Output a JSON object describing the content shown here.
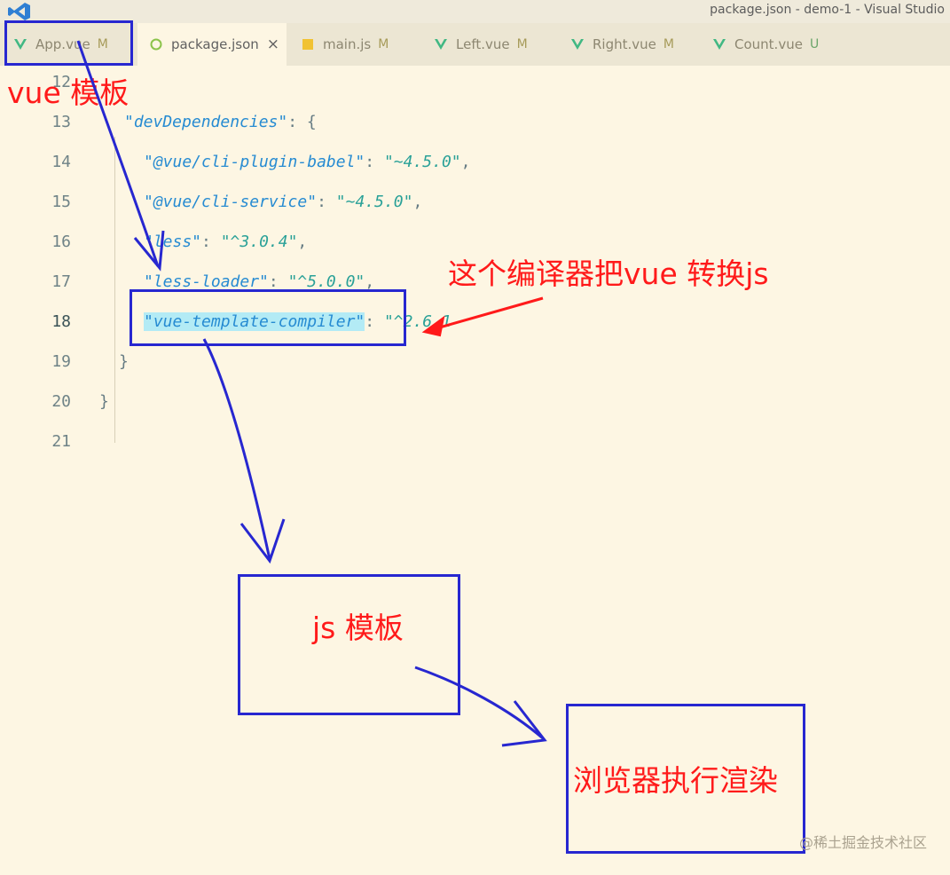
{
  "window": {
    "title": "package.json - demo-1 - Visual Studio"
  },
  "tabs": [
    {
      "label": "App.vue",
      "badge": "M",
      "icon": "vue-icon",
      "active": false
    },
    {
      "label": "package.json",
      "badge": "",
      "icon": "json-icon",
      "active": true,
      "close": "×"
    },
    {
      "label": "main.js",
      "badge": "M",
      "icon": "js-icon",
      "active": false
    },
    {
      "label": "Left.vue",
      "badge": "M",
      "icon": "vue-icon",
      "active": false
    },
    {
      "label": "Right.vue",
      "badge": "M",
      "icon": "vue-icon",
      "active": false
    },
    {
      "label": "Count.vue",
      "badge": "U",
      "icon": "vue-icon",
      "active": false
    }
  ],
  "editor": {
    "lines": [
      {
        "num": "12",
        "key": "",
        "value": ""
      },
      {
        "num": "13",
        "key": "\"devDependencies\"",
        "sep": ": {",
        "value": ""
      },
      {
        "num": "14",
        "key": "\"@vue/cli-plugin-babel\"",
        "sep": ": ",
        "value": "\"~4.5.0\"",
        "end": ","
      },
      {
        "num": "15",
        "key": "\"@vue/cli-service\"",
        "sep": ": ",
        "value": "\"~4.5.0\"",
        "end": ","
      },
      {
        "num": "16",
        "key": "\"less\"",
        "sep": ": ",
        "value": "\"^3.0.4\"",
        "end": ","
      },
      {
        "num": "17",
        "key": "\"less-loader\"",
        "sep": ": ",
        "value": "\"^5.0.0\"",
        "end": ","
      },
      {
        "num": "18",
        "key": "\"vue-template-compiler\"",
        "sep": ": ",
        "value": "\"^2.6.1",
        "end": ""
      },
      {
        "num": "19",
        "key": "",
        "sep": "}",
        "value": ""
      },
      {
        "num": "20",
        "key": "",
        "sep": "}",
        "value": ""
      },
      {
        "num": "21",
        "key": "",
        "sep": "",
        "value": ""
      }
    ]
  },
  "annotations": {
    "vue_template": "vue 模板",
    "compiler_note": "这个编译器把vue 转换js",
    "js_template": "js 模板",
    "browser_render": "浏览器执行渲染"
  },
  "watermark": "@稀土掘金技术社区",
  "colors": {
    "annotation_red": "#ff1a1a",
    "annotation_blue": "#2727d0",
    "editor_bg": "#fdf6e3"
  }
}
